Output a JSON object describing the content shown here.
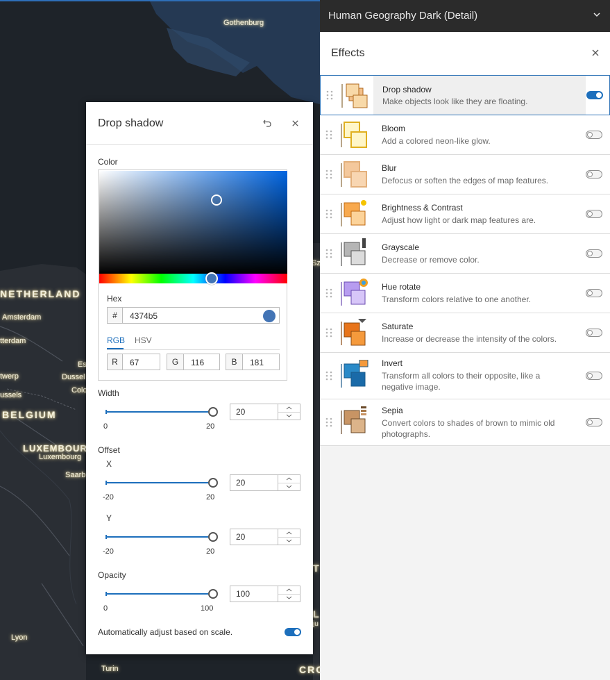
{
  "map": {
    "labels": {
      "gothenburg": "Gothenburg",
      "netherlands": "NETHERLAND",
      "amsterdam": "Amsterdam",
      "rotterdam": "tterdam",
      "antwerp": "twerp",
      "brussels": "ussels",
      "belgium": "BELGIUM",
      "luxembourg_country": "LUXEMBOUR",
      "luxembourg_city": "Luxembourg",
      "saarbrucken": "Saarb",
      "essen": "Es",
      "dusseldorf": "Dussel",
      "cologne": "Colo",
      "lyon": "Lyon",
      "turin": "Turin",
      "croatia": "CRO",
      "sz": "Sz",
      "t_frag": "T",
      "l_frag": "L",
      "ju_frag": "ju"
    }
  },
  "basemap": {
    "title": "Human Geography Dark (Detail)",
    "chevron_icon": "chevron-down-icon"
  },
  "effects_panel": {
    "title": "Effects",
    "close_icon": "close-icon",
    "items": [
      {
        "name": "Drop shadow",
        "desc": "Make objects look like they are floating.",
        "enabled": true,
        "selected": true
      },
      {
        "name": "Bloom",
        "desc": "Add a colored neon-like glow.",
        "enabled": false
      },
      {
        "name": "Blur",
        "desc": "Defocus or soften the edges of map features.",
        "enabled": false
      },
      {
        "name": "Brightness & Contrast",
        "desc": "Adjust how light or dark map features are.",
        "enabled": false
      },
      {
        "name": "Grayscale",
        "desc": "Decrease or remove color.",
        "enabled": false
      },
      {
        "name": "Hue rotate",
        "desc": "Transform colors relative to one another.",
        "enabled": false
      },
      {
        "name": "Saturate",
        "desc": "Increase or decrease the intensity of the colors.",
        "enabled": false
      },
      {
        "name": "Invert",
        "desc": "Transform all colors to their opposite, like a negative image.",
        "enabled": false
      },
      {
        "name": "Sepia",
        "desc": "Convert colors to shades of brown to mimic old photographs.",
        "enabled": false
      }
    ]
  },
  "dialog": {
    "title": "Drop shadow",
    "reset_icon": "undo-icon",
    "close_icon": "close-icon",
    "color_label": "Color",
    "hex_label": "Hex",
    "hex_prefix": "#",
    "hex_value": "4374b5",
    "swatch_color": "#4374b5",
    "tab_rgb": "RGB",
    "tab_hsv": "HSV",
    "r_label": "R",
    "r_value": "67",
    "g_label": "G",
    "g_value": "116",
    "b_label": "B",
    "b_value": "181",
    "width_label": "Width",
    "width_min": "0",
    "width_max": "20",
    "width_value": "20",
    "offset_label": "Offset",
    "x_label": "X",
    "x_min": "-20",
    "x_max": "20",
    "x_value": "20",
    "y_label": "Y",
    "y_min": "-20",
    "y_max": "20",
    "y_value": "20",
    "opacity_label": "Opacity",
    "opacity_min": "0",
    "opacity_max": "100",
    "opacity_value": "100",
    "auto_adjust_label": "Automatically adjust based on scale.",
    "auto_adjust_enabled": true
  },
  "colors": {
    "accent": "#1d6fbc",
    "panel_header": "#2b2b2b",
    "map_background": "#22272d"
  }
}
